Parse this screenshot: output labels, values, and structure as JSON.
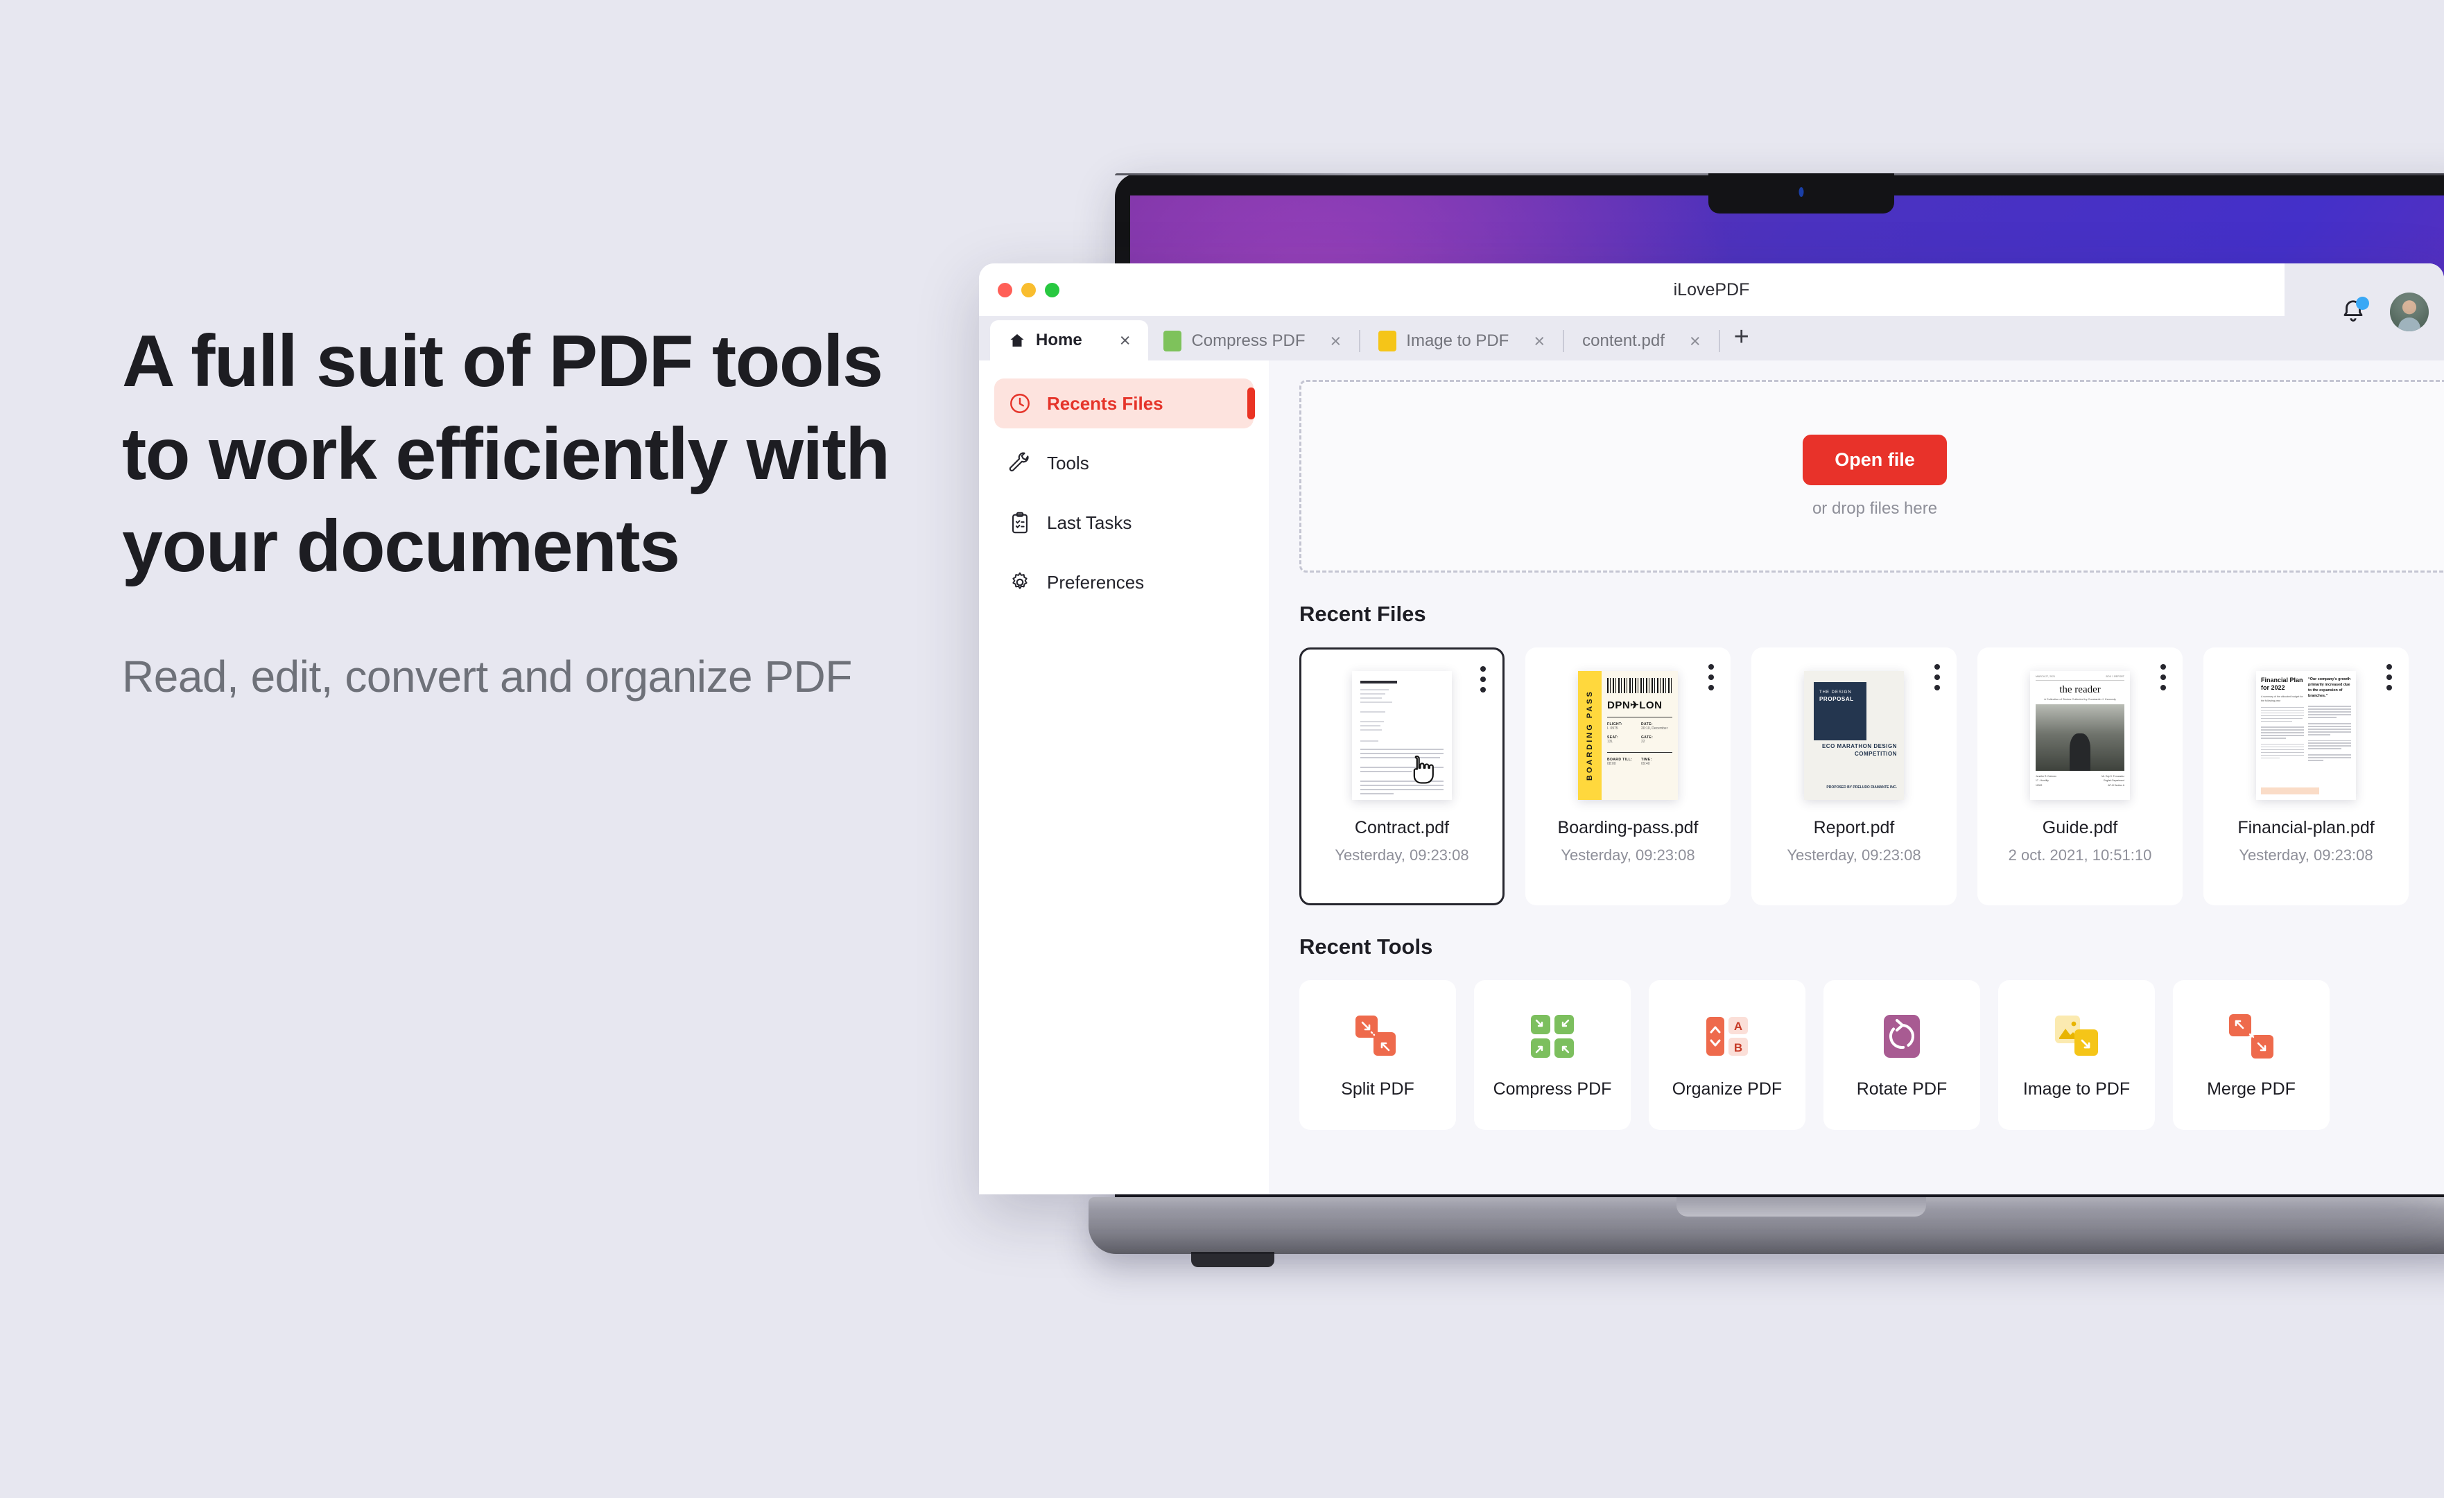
{
  "marketing": {
    "headline": "A full suit of PDF tools to work efficiently with your documents",
    "subcopy": "Read, edit, convert and organize PDF"
  },
  "window": {
    "app_title": "iLovePDF",
    "traffic_lights": [
      "close-red",
      "minimize-yellow",
      "maximize-green"
    ]
  },
  "tabs": [
    {
      "label": "Home",
      "icon": "home-icon",
      "active": true,
      "close": "×"
    },
    {
      "label": "Compress PDF",
      "icon": "compress-pdf-icon",
      "active": false,
      "close": "×"
    },
    {
      "label": "Image to PDF",
      "icon": "image-to-pdf-icon",
      "active": false,
      "close": "×"
    },
    {
      "label": "content.pdf",
      "icon": "",
      "active": false,
      "close": "×"
    }
  ],
  "new_tab_label": "+",
  "sidebar": {
    "items": [
      {
        "label": "Recents Files",
        "icon": "clock-icon",
        "active": true
      },
      {
        "label": "Tools",
        "icon": "wrench-icon",
        "active": false
      },
      {
        "label": "Last Tasks",
        "icon": "clipboard-check-icon",
        "active": false
      },
      {
        "label": "Preferences",
        "icon": "gear-icon",
        "active": false
      }
    ]
  },
  "dropzone": {
    "button_label": "Open file",
    "hint": "or drop files here"
  },
  "recent_files": {
    "title": "Recent Files",
    "items": [
      {
        "name": "Contract.pdf",
        "date": "Yesterday, 09:23:08",
        "selected": true,
        "thumb": {
          "kind": "letter",
          "company": "Our Company"
        }
      },
      {
        "name": "Boarding-pass.pdf",
        "date": "Yesterday, 09:23:08",
        "selected": false,
        "thumb": {
          "kind": "boarding-pass",
          "strip": "BOARDING PASS",
          "route": "DPN✈LON",
          "fields": [
            {
              "k": "FLIGHT:",
              "v": "I· 0975"
            },
            {
              "k": "DATE:",
              "v": "20:10, December"
            },
            {
              "k": "SEAT:",
              "v": "13L"
            },
            {
              "k": "GATE:",
              "v": "22"
            },
            {
              "k": "BOARD TILL:",
              "v": "08:00"
            },
            {
              "k": "TIME:",
              "v": "09:40"
            }
          ]
        }
      },
      {
        "name": "Report.pdf",
        "date": "Yesterday, 09:23:08",
        "selected": false,
        "thumb": {
          "kind": "proposal",
          "kicker": "THE DESIGN",
          "label": "PROPOSAL",
          "title": "ECO MARATHON DESIGN COMPETITION",
          "footer": "PROPOSED BY PRELUDO DIAMANTE INC."
        }
      },
      {
        "name": "Guide.pdf",
        "date": "2 oct. 2021, 10:51:10",
        "selected": false,
        "thumb": {
          "kind": "newspaper",
          "masthead": "the reader",
          "subtitle": "A Collection of Stories Collected by Constantin J. Kennedy",
          "top_left": "MARCH 27, 2021",
          "top_right": "BOX 1 REPORT"
        }
      },
      {
        "name": "Financial-plan.pdf",
        "date": "Yesterday, 09:23:08",
        "selected": false,
        "thumb": {
          "kind": "financial",
          "heading": "Financial Plan for 2022",
          "sub": "A summary of the allocated budget for the following year",
          "quote": "“Our company's growth primarily increased due to the expansion of branches.”"
        }
      }
    ]
  },
  "recent_tools": {
    "title": "Recent Tools",
    "items": [
      {
        "label": "Split PDF",
        "icon": "split-pdf-icon",
        "color": "#ee6a4c"
      },
      {
        "label": "Compress PDF",
        "icon": "compress-pdf-icon",
        "color": "#7cbf5e"
      },
      {
        "label": "Organize PDF",
        "icon": "organize-pdf-icon",
        "color": "#ee6a4c",
        "a": "A",
        "b": "B"
      },
      {
        "label": "Rotate PDF",
        "icon": "rotate-pdf-icon",
        "color": "#a85b92"
      },
      {
        "label": "Image to PDF",
        "icon": "image-to-pdf-icon",
        "color": "#f5c518"
      },
      {
        "label": "Merge PDF",
        "icon": "merge-pdf-icon",
        "color": "#ee6a4c"
      }
    ]
  },
  "colors": {
    "brand_red": "#e8322a",
    "accent_soft_red": "#fde3de",
    "page_background": "#e7e7f0",
    "panel_background": "#f6f6fa",
    "notification_badge": "#3aa8f5"
  }
}
